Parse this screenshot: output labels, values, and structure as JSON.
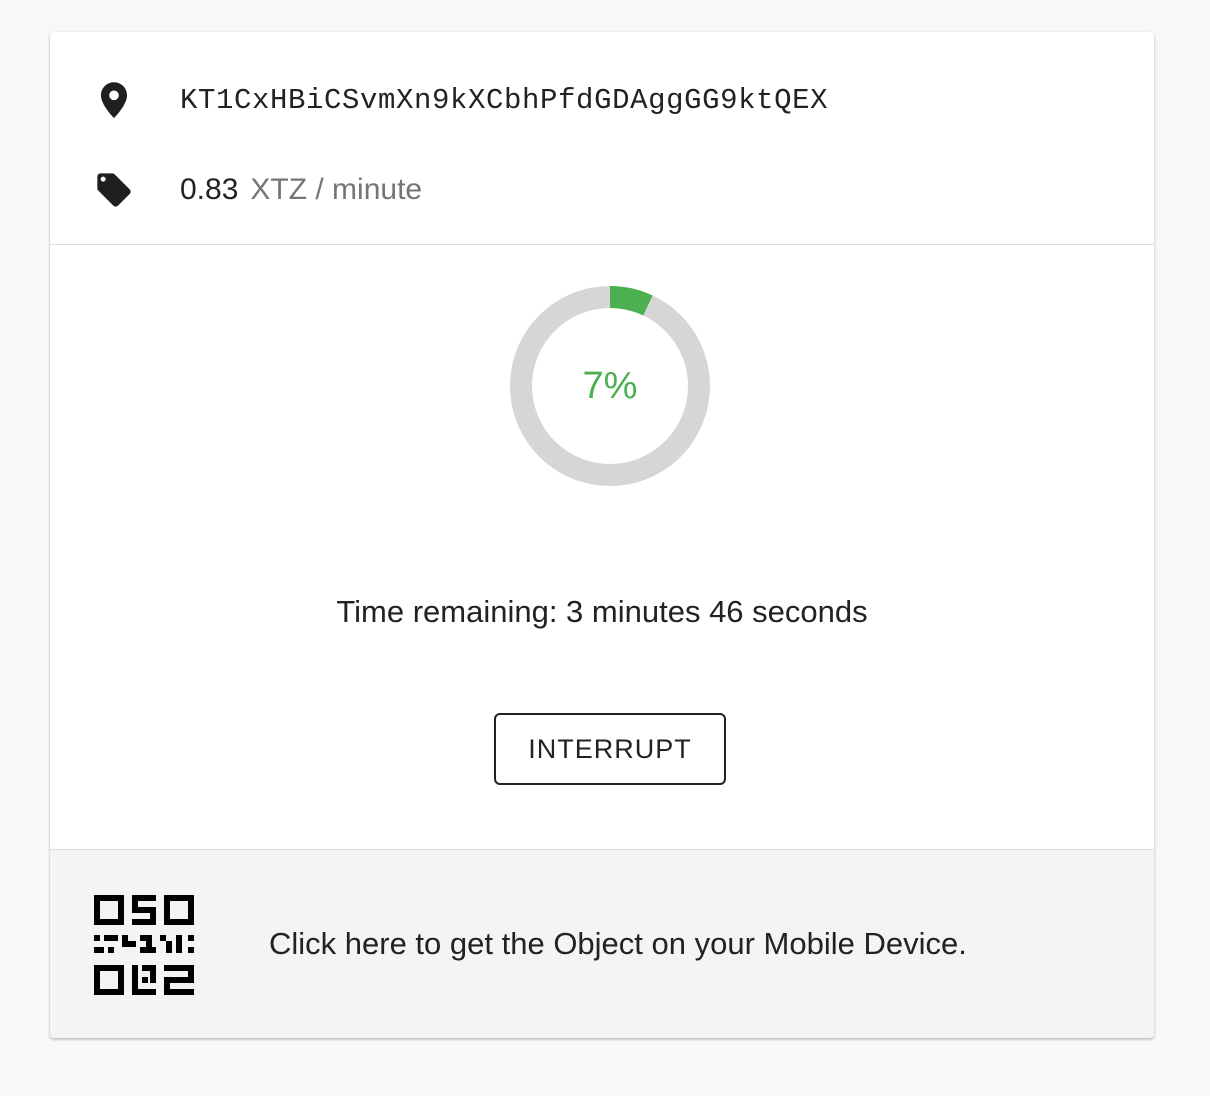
{
  "contract": {
    "address": "KT1CxHBiCSvmXn9kXCbhPfdGDAggGG9ktQEX",
    "address_icon": "location-pin-icon"
  },
  "price": {
    "value": "0.83",
    "unit": "XTZ / minute",
    "icon": "price-tag-icon"
  },
  "progress": {
    "percent": 7,
    "label": "7%",
    "color": "#4caf50",
    "track_color": "#d6d6d6"
  },
  "timer": {
    "text": "Time remaining: 3 minutes 46 seconds"
  },
  "actions": {
    "interrupt_label": "INTERRUPT"
  },
  "mobile": {
    "text": "Click here to get the Object on your Mobile Device.",
    "icon": "qr-code-icon"
  }
}
